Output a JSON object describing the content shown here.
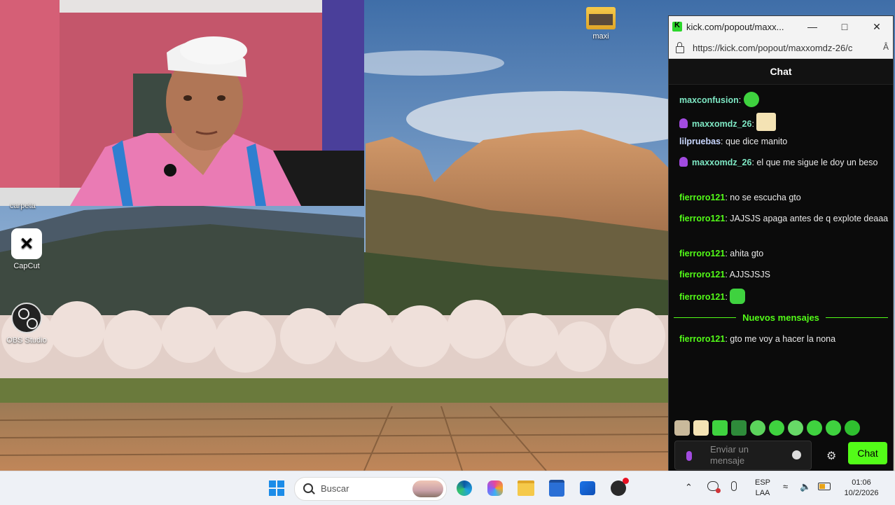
{
  "desktop": {
    "icons": [
      {
        "label": "maxi",
        "icon": "folder-icon"
      },
      {
        "label": "CapCut",
        "icon": "capcut-icon"
      },
      {
        "label": "OBS Studio",
        "icon": "obs-icon"
      }
    ],
    "partial_label": "carpeta"
  },
  "browser": {
    "title": "kick.com/popout/maxx...",
    "url": "https://kick.com/popout/maxxomdz-26/c",
    "reader_icon": "Â"
  },
  "chat": {
    "header": "Chat",
    "messages": [
      {
        "user": "maxconfusion",
        "text": "",
        "emote": "green-blob-emote",
        "badge": false,
        "color": "u-teal"
      },
      {
        "user": "maxxomdz_26",
        "text": "",
        "emote": "anime-face-emote",
        "badge": true,
        "color": "u-teal"
      },
      {
        "user": "lilpruebas",
        "text": "que dice manito",
        "badge": false,
        "color": "u-blue"
      },
      {
        "user": "maxxomdz_26",
        "text": "el que me sigue le doy un beso",
        "badge": true,
        "color": "u-teal"
      },
      {
        "user": "fierroro121",
        "text": "no se escucha gto",
        "badge": false,
        "color": "u-green"
      },
      {
        "user": "fierroro121",
        "text": "JAJSJS apaga antes de q explote deaaa",
        "badge": false,
        "color": "u-green"
      },
      {
        "user": "fierroro121",
        "text": "ahita gto",
        "badge": false,
        "color": "u-green"
      },
      {
        "user": "fierroro121",
        "text": "AJJSJSJS",
        "badge": false,
        "color": "u-green"
      },
      {
        "user": "fierroro121",
        "text": "",
        "emote": "green-face-emote",
        "badge": false,
        "color": "u-green"
      }
    ],
    "new_messages_label": "Nuevos mensajes",
    "after_divider": {
      "user": "fierroro121",
      "text": "gto me voy a hacer la nona"
    },
    "input_placeholder": "Enviar un mensaje",
    "send_label": "Chat",
    "accent": "#53fc18"
  },
  "taskbar": {
    "search_placeholder": "Buscar",
    "lang_top": "ESP",
    "lang_bottom": "LAA",
    "time": "01:06",
    "date": "10/2/2026"
  }
}
